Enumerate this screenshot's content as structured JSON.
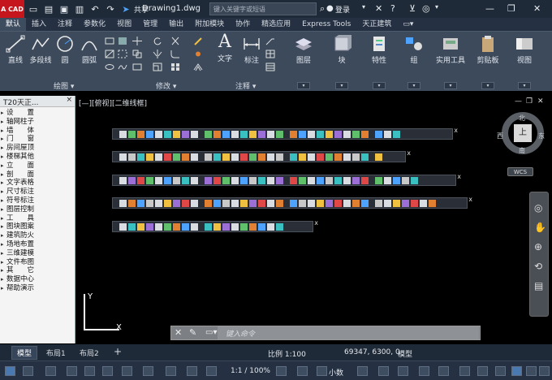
{
  "app": {
    "logo": "A CAD",
    "title": "Drawing1.dwg",
    "share_label": "共享",
    "search_placeholder": "键入关键字或短语",
    "login_label": "登录"
  },
  "menu": {
    "tabs": [
      "默认",
      "插入",
      "注释",
      "参数化",
      "视图",
      "管理",
      "输出",
      "附加模块",
      "协作",
      "精选应用",
      "Express Tools",
      "天正建筑"
    ]
  },
  "ribbon": {
    "draw": {
      "items": [
        "直线",
        "多段线",
        "圆",
        "圆弧"
      ],
      "group_label": "绘图 ▾"
    },
    "modify": {
      "group_label": "修改 ▾"
    },
    "annotation": {
      "items": [
        "文字",
        "标注"
      ],
      "group_label": "注释 ▾"
    },
    "big_buttons": [
      "图层",
      "块",
      "特性",
      "组",
      "实用工具",
      "剪贴板",
      "视图"
    ]
  },
  "left_panel": {
    "title": "T20天正...",
    "close": "×",
    "items": [
      "设　　置",
      "轴网柱子",
      "墙　　体",
      "门　　窗",
      "房间屋顶",
      "楼梯其他",
      "立　　面",
      "剖　　面",
      "文字表格",
      "尺寸标注",
      "符号标注",
      "图层控制",
      "工　　具",
      "图块图案",
      "建筑防火",
      "场地布置",
      "三维建模",
      "文件布图",
      "其　　它",
      "数据中心",
      "帮助演示"
    ]
  },
  "viewport": {
    "label": "[—][俯视][二维线框]"
  },
  "viewcube": {
    "top": "上",
    "north": "北",
    "south": "南",
    "east": "东",
    "west": "西",
    "wcs": "WCS"
  },
  "ucs": {
    "x": "X",
    "y": "Y"
  },
  "command": {
    "placeholder": "键入命令"
  },
  "layouts": {
    "tabs": [
      "模型",
      "布局1",
      "布局2"
    ],
    "add": "+"
  },
  "status": {
    "scale": "比例 1:100",
    "coords": "69347, 6300, 0",
    "model": "模型",
    "zoom": "1:1 / 100%",
    "units": "小数"
  },
  "colors": {
    "accent": "#c4161c",
    "ribbon": "#3c4a5c",
    "titlebar": "#1f2a38"
  }
}
